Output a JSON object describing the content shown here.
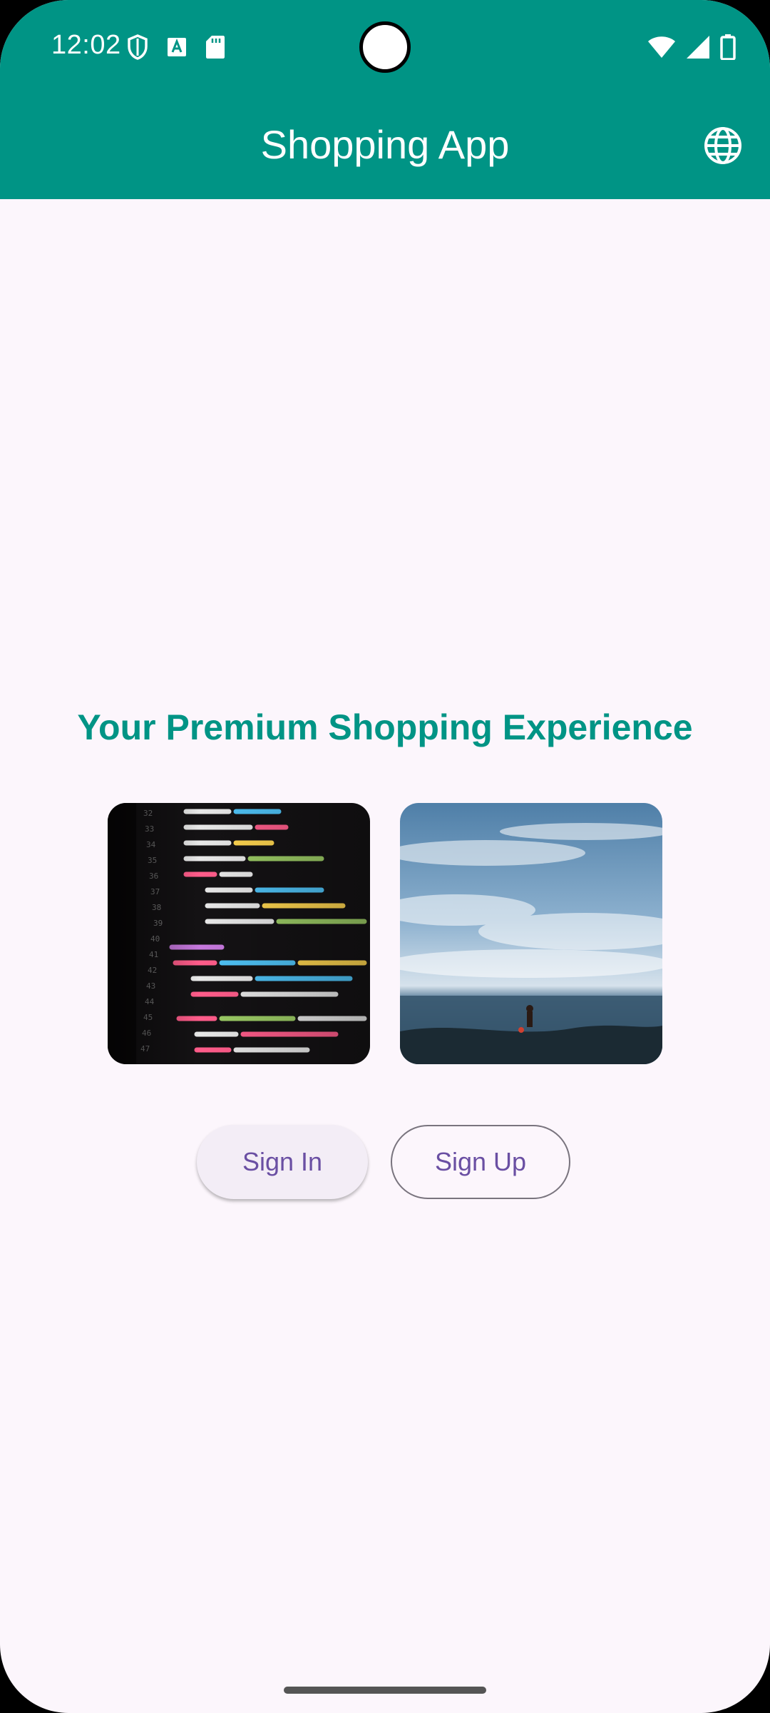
{
  "status_bar": {
    "time": "12:02",
    "left_icons": [
      "shield-icon",
      "font-icon",
      "sd-card-icon"
    ],
    "right_icons": [
      "wifi-icon",
      "signal-icon",
      "battery-icon"
    ]
  },
  "toolbar": {
    "title": "Shopping App",
    "action_icon": "globe-icon"
  },
  "main": {
    "tagline": "Your Premium Shopping Experience",
    "images": [
      "code-screen-photo",
      "ocean-sky-photo"
    ],
    "sign_in_label": "Sign In",
    "sign_up_label": "Sign Up"
  },
  "colors": {
    "primary": "#009485",
    "background": "#FCF6FC",
    "button_text": "#6A4FA3"
  }
}
